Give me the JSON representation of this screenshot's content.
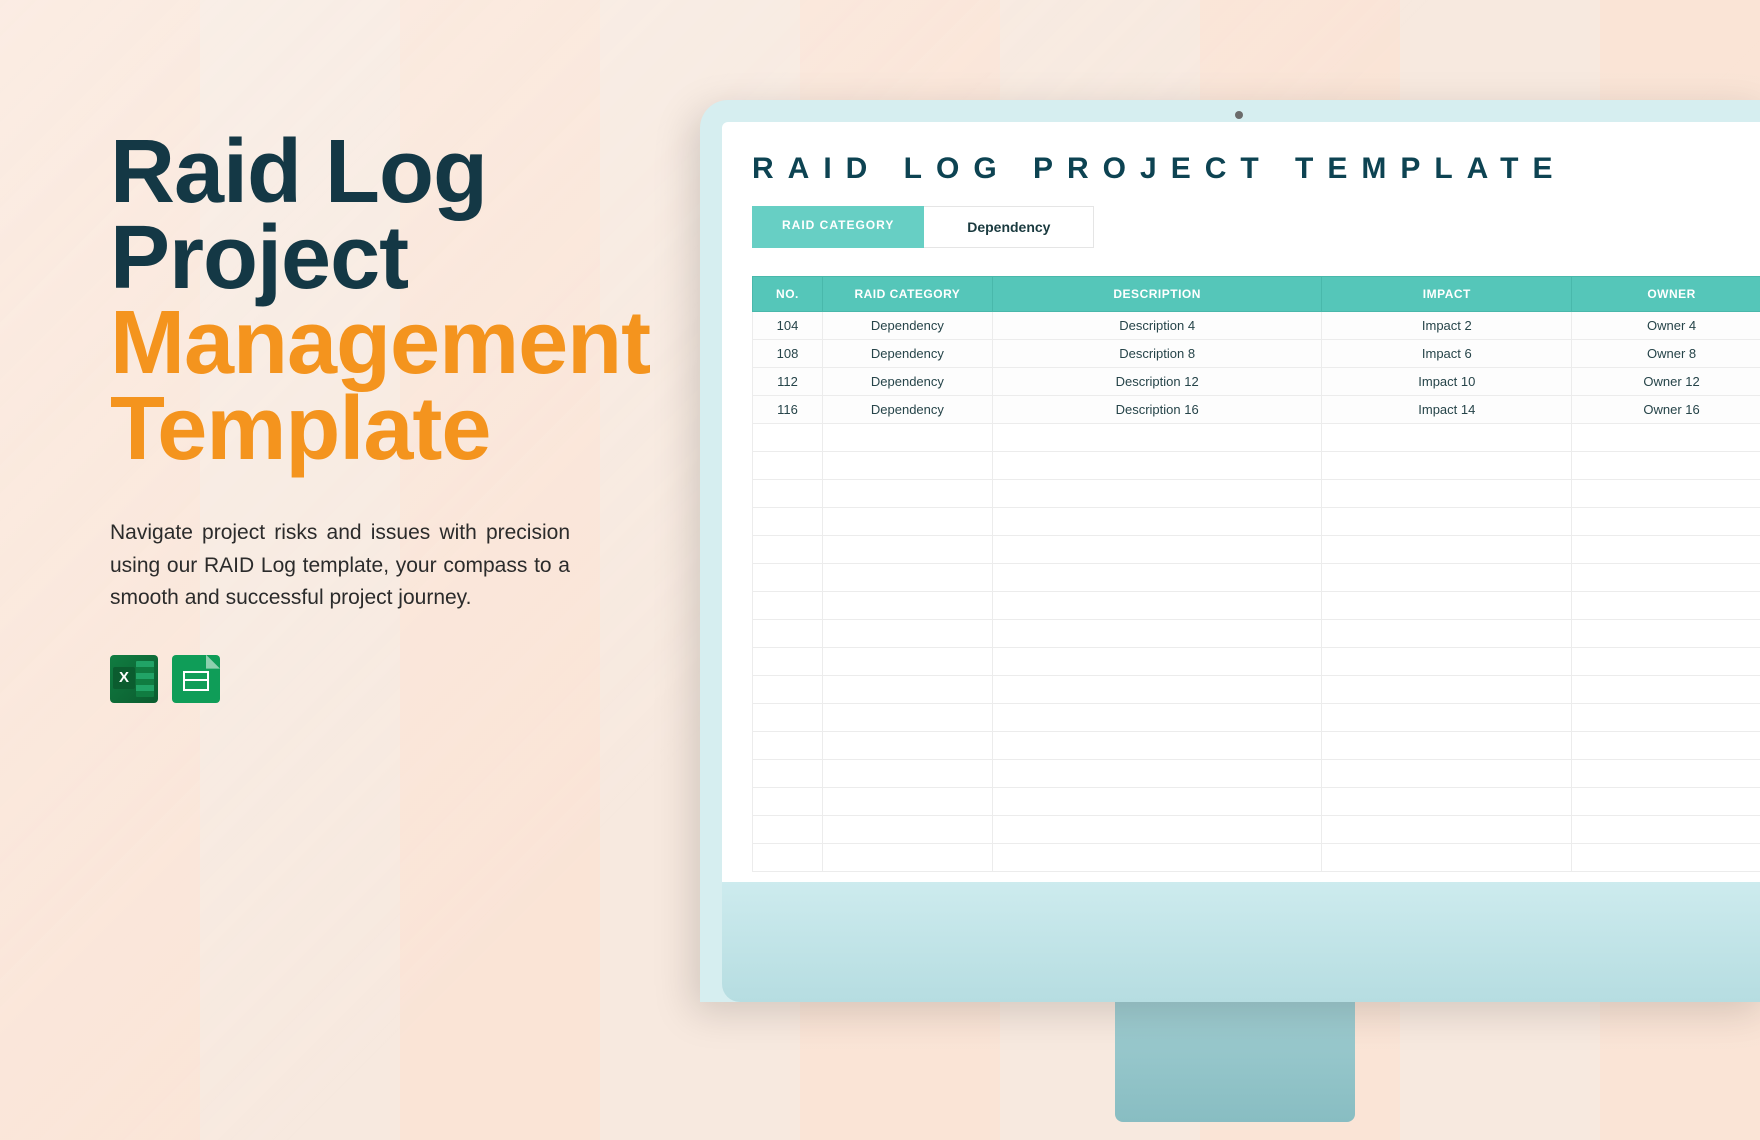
{
  "hero": {
    "line1": "Raid Log",
    "line2": "Project",
    "line3": "Management",
    "line4": "Template",
    "description": "Navigate project risks and issues with precision using our RAID Log template, your compass to a smooth and successful project journey."
  },
  "icons": {
    "excel": "excel-icon",
    "sheets": "google-sheets-icon"
  },
  "spreadsheet": {
    "title": "RAID LOG PROJECT TEMPLATE",
    "tabs": {
      "active": "RAID CATEGORY",
      "inactive": "Dependency"
    },
    "columns": [
      "NO.",
      "RAID CATEGORY",
      "DESCRIPTION",
      "IMPACT",
      "OWNER"
    ],
    "rows": [
      {
        "no": "104",
        "cat": "Dependency",
        "desc": "Description 4",
        "impact": "Impact 2",
        "owner": "Owner 4"
      },
      {
        "no": "108",
        "cat": "Dependency",
        "desc": "Description 8",
        "impact": "Impact 6",
        "owner": "Owner 8"
      },
      {
        "no": "112",
        "cat": "Dependency",
        "desc": "Description 12",
        "impact": "Impact 10",
        "owner": "Owner 12"
      },
      {
        "no": "116",
        "cat": "Dependency",
        "desc": "Description 16",
        "impact": "Impact 14",
        "owner": "Owner 16"
      }
    ],
    "empty_row_count": 16
  },
  "colors": {
    "title_dark": "#143845",
    "title_orange": "#f4941e",
    "accent_teal": "#55c6b9",
    "monitor_frame": "#d6eef0"
  }
}
